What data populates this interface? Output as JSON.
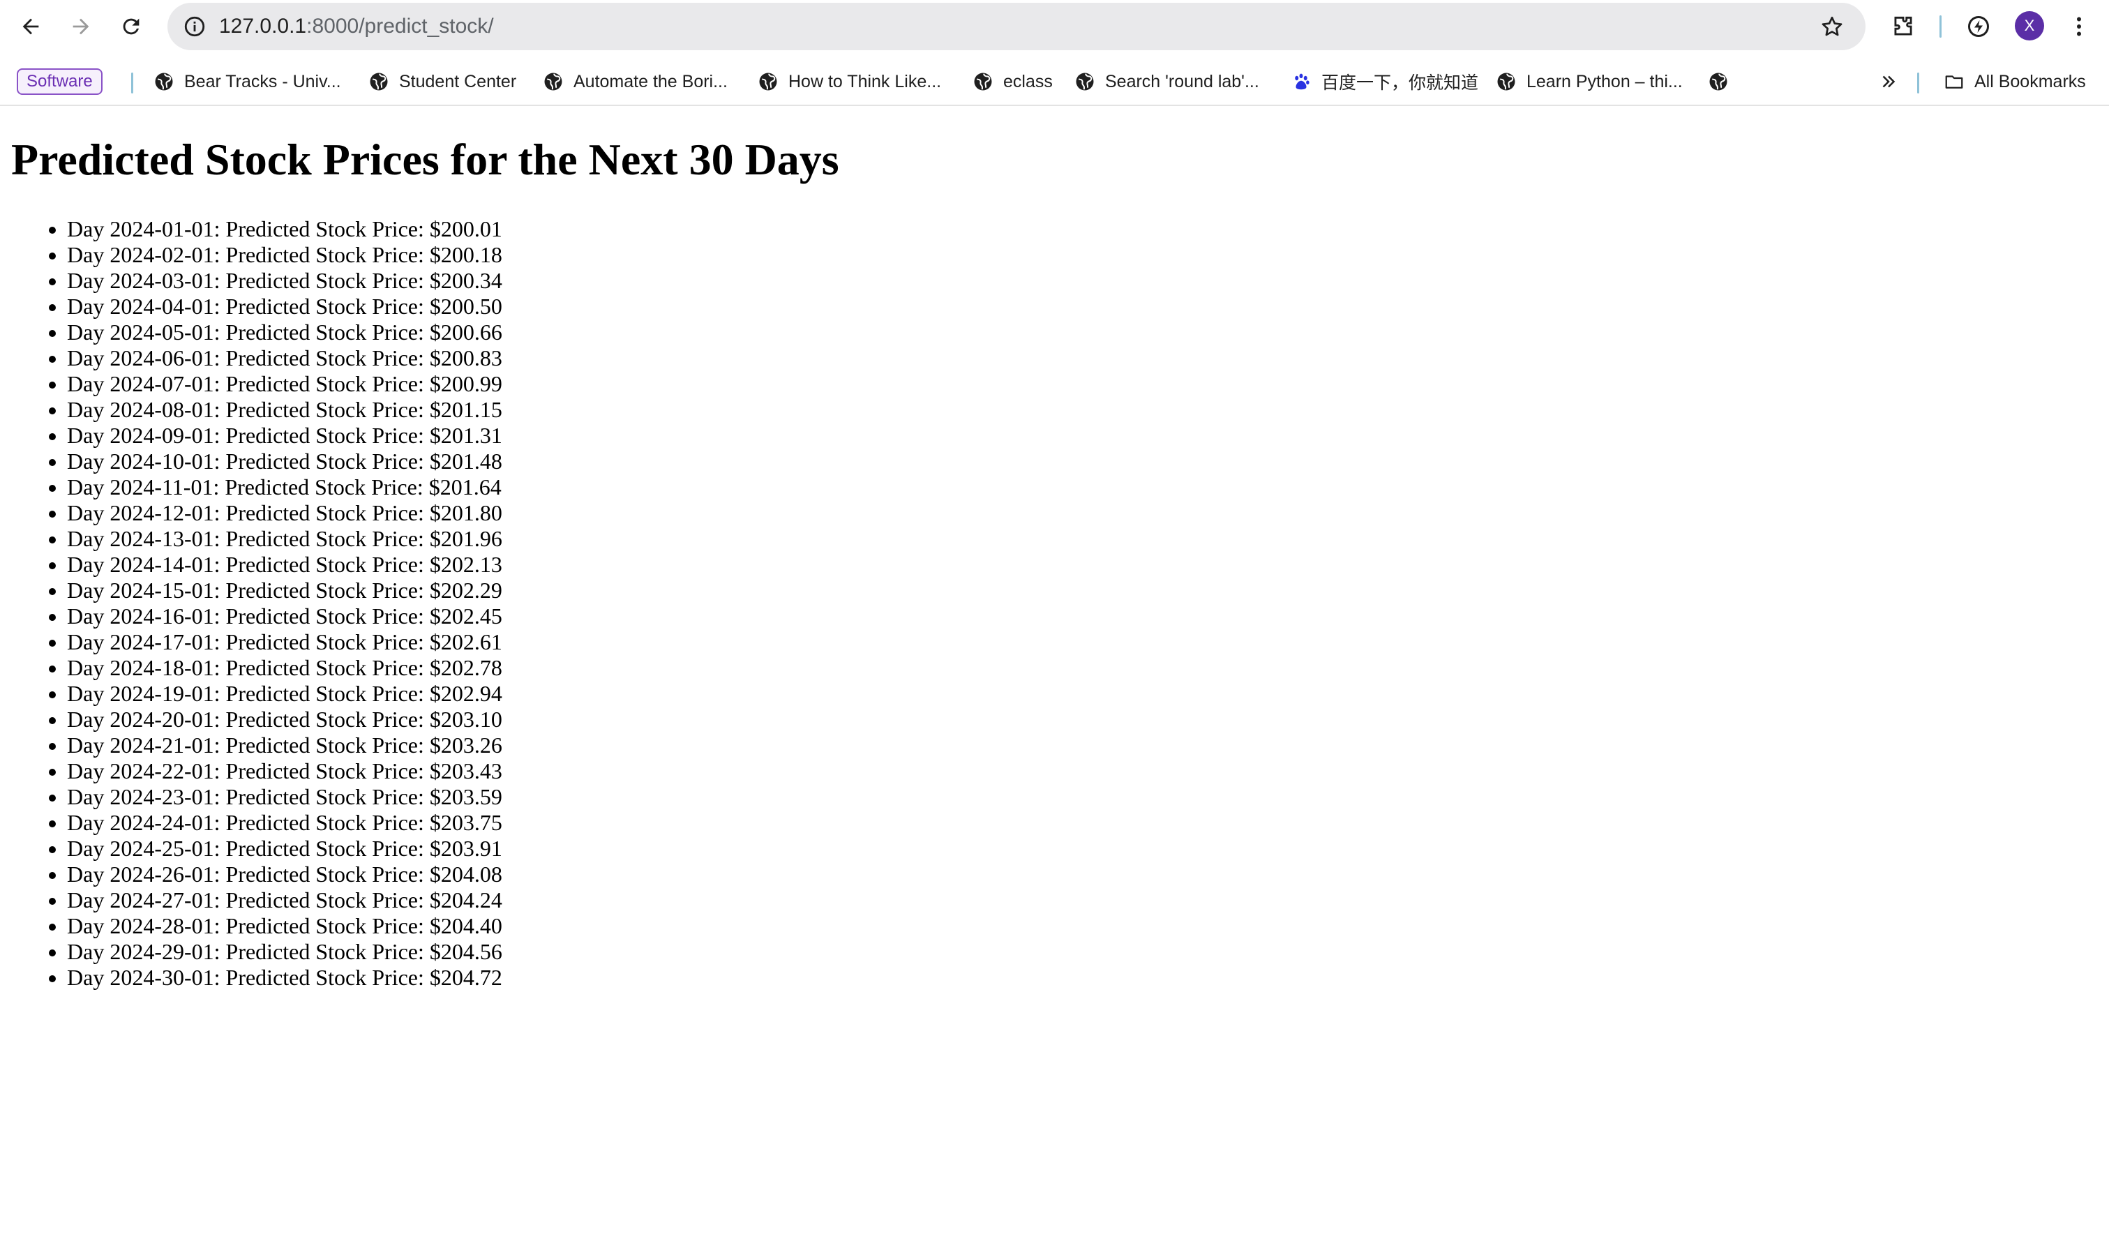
{
  "browser": {
    "url_host": "127.0.0.1",
    "url_path": ":8000/predict_stock/",
    "avatar_initial": "X",
    "bookmarks": [
      {
        "label": "Software",
        "type": "folder-chip"
      },
      {
        "label": "Bear Tracks - Univ...",
        "icon": "globe-icon"
      },
      {
        "label": "Student Center",
        "icon": "globe-icon"
      },
      {
        "label": "Automate the Bori...",
        "icon": "globe-icon"
      },
      {
        "label": "How to Think Like...",
        "icon": "globe-icon"
      },
      {
        "label": "eclass",
        "icon": "globe-icon"
      },
      {
        "label": "Search 'round lab'...",
        "icon": "globe-icon"
      },
      {
        "label": "百度一下，你就知道",
        "icon": "baidu-paw-icon"
      },
      {
        "label": "Learn Python – thi...",
        "icon": "globe-icon"
      },
      {
        "label": "",
        "icon": "globe-icon"
      }
    ],
    "all_bookmarks_label": "All Bookmarks"
  },
  "page": {
    "title": "Predicted Stock Prices for the Next 30 Days",
    "predictions": [
      "Day 2024-01-01: Predicted Stock Price: $200.01",
      "Day 2024-02-01: Predicted Stock Price: $200.18",
      "Day 2024-03-01: Predicted Stock Price: $200.34",
      "Day 2024-04-01: Predicted Stock Price: $200.50",
      "Day 2024-05-01: Predicted Stock Price: $200.66",
      "Day 2024-06-01: Predicted Stock Price: $200.83",
      "Day 2024-07-01: Predicted Stock Price: $200.99",
      "Day 2024-08-01: Predicted Stock Price: $201.15",
      "Day 2024-09-01: Predicted Stock Price: $201.31",
      "Day 2024-10-01: Predicted Stock Price: $201.48",
      "Day 2024-11-01: Predicted Stock Price: $201.64",
      "Day 2024-12-01: Predicted Stock Price: $201.80",
      "Day 2024-13-01: Predicted Stock Price: $201.96",
      "Day 2024-14-01: Predicted Stock Price: $202.13",
      "Day 2024-15-01: Predicted Stock Price: $202.29",
      "Day 2024-16-01: Predicted Stock Price: $202.45",
      "Day 2024-17-01: Predicted Stock Price: $202.61",
      "Day 2024-18-01: Predicted Stock Price: $202.78",
      "Day 2024-19-01: Predicted Stock Price: $202.94",
      "Day 2024-20-01: Predicted Stock Price: $203.10",
      "Day 2024-21-01: Predicted Stock Price: $203.26",
      "Day 2024-22-01: Predicted Stock Price: $203.43",
      "Day 2024-23-01: Predicted Stock Price: $203.59",
      "Day 2024-24-01: Predicted Stock Price: $203.75",
      "Day 2024-25-01: Predicted Stock Price: $203.91",
      "Day 2024-26-01: Predicted Stock Price: $204.08",
      "Day 2024-27-01: Predicted Stock Price: $204.24",
      "Day 2024-28-01: Predicted Stock Price: $204.40",
      "Day 2024-29-01: Predicted Stock Price: $204.56",
      "Day 2024-30-01: Predicted Stock Price: $204.72"
    ]
  }
}
